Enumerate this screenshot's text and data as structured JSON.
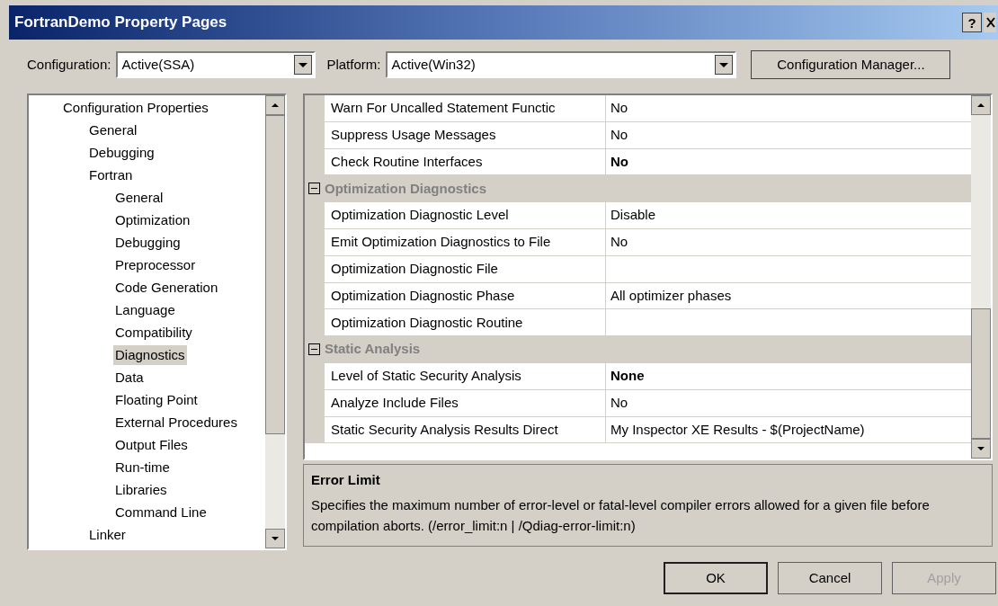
{
  "window": {
    "title": "FortranDemo Property Pages",
    "help_button": "?"
  },
  "toolbar": {
    "configuration": {
      "label": "Configuration:",
      "value": "Active(SSA)"
    },
    "platform": {
      "label": "Platform:",
      "value": "Active(Win32)"
    },
    "manager_button": "Configuration Manager..."
  },
  "tree": [
    {
      "label": "Configuration Properties",
      "selected": false,
      "children": [
        {
          "label": "General",
          "selected": false
        },
        {
          "label": "Debugging",
          "selected": false
        },
        {
          "label": "Fortran",
          "selected": false,
          "children": [
            {
              "label": "General",
              "selected": false
            },
            {
              "label": "Optimization",
              "selected": false
            },
            {
              "label": "Debugging",
              "selected": false
            },
            {
              "label": "Preprocessor",
              "selected": false
            },
            {
              "label": "Code Generation",
              "selected": false
            },
            {
              "label": "Language",
              "selected": false
            },
            {
              "label": "Compatibility",
              "selected": false
            },
            {
              "label": "Diagnostics",
              "selected": true
            },
            {
              "label": "Data",
              "selected": false
            },
            {
              "label": "Floating Point",
              "selected": false
            },
            {
              "label": "External Procedures",
              "selected": false
            },
            {
              "label": "Output Files",
              "selected": false
            },
            {
              "label": "Run-time",
              "selected": false
            },
            {
              "label": "Libraries",
              "selected": false
            },
            {
              "label": "Command Line",
              "selected": false
            }
          ]
        },
        {
          "label": "Linker",
          "selected": false
        }
      ]
    }
  ],
  "grid": [
    {
      "kind": "property",
      "name": "Warn For Uncalled Statement Functic",
      "value": "No",
      "bold": false
    },
    {
      "kind": "property",
      "name": "Suppress Usage Messages",
      "value": "No",
      "bold": false
    },
    {
      "kind": "property",
      "name": "Check Routine Interfaces",
      "value": "No",
      "bold": true
    },
    {
      "kind": "category",
      "name": "Optimization Diagnostics",
      "expanded": true
    },
    {
      "kind": "property",
      "name": "Optimization Diagnostic Level",
      "value": "Disable",
      "bold": false
    },
    {
      "kind": "property",
      "name": "Emit Optimization Diagnostics to File",
      "value": "No",
      "bold": false
    },
    {
      "kind": "property",
      "name": "Optimization Diagnostic File"
    },
    {
      "kind": "property",
      "name": "Optimization Diagnostic Phase",
      "value": "All optimizer phases",
      "bold": false
    },
    {
      "kind": "property",
      "name": "Optimization Diagnostic Routine"
    },
    {
      "kind": "category",
      "name": "Static Analysis",
      "expanded": true
    },
    {
      "kind": "property",
      "name": "Level of Static Security Analysis",
      "value": "None",
      "bold": true
    },
    {
      "kind": "property",
      "name": "Analyze Include Files",
      "value": "No",
      "bold": false
    },
    {
      "kind": "property",
      "name": "Static Security Analysis Results Direct",
      "value": "My Inspector XE Results - $(ProjectName)",
      "bold": false
    }
  ],
  "description": {
    "title": "Error Limit",
    "text": "Specifies the maximum number of error-level or fatal-level compiler errors allowed for a given file before compilation aborts. (/error_limit:n | /Qdiag-error-limit:n)"
  },
  "buttons": [
    {
      "label": "OK",
      "disabled": false,
      "default": true
    },
    {
      "label": "Cancel",
      "disabled": false,
      "default": false
    },
    {
      "label": "Apply",
      "disabled": true,
      "default": false
    }
  ]
}
